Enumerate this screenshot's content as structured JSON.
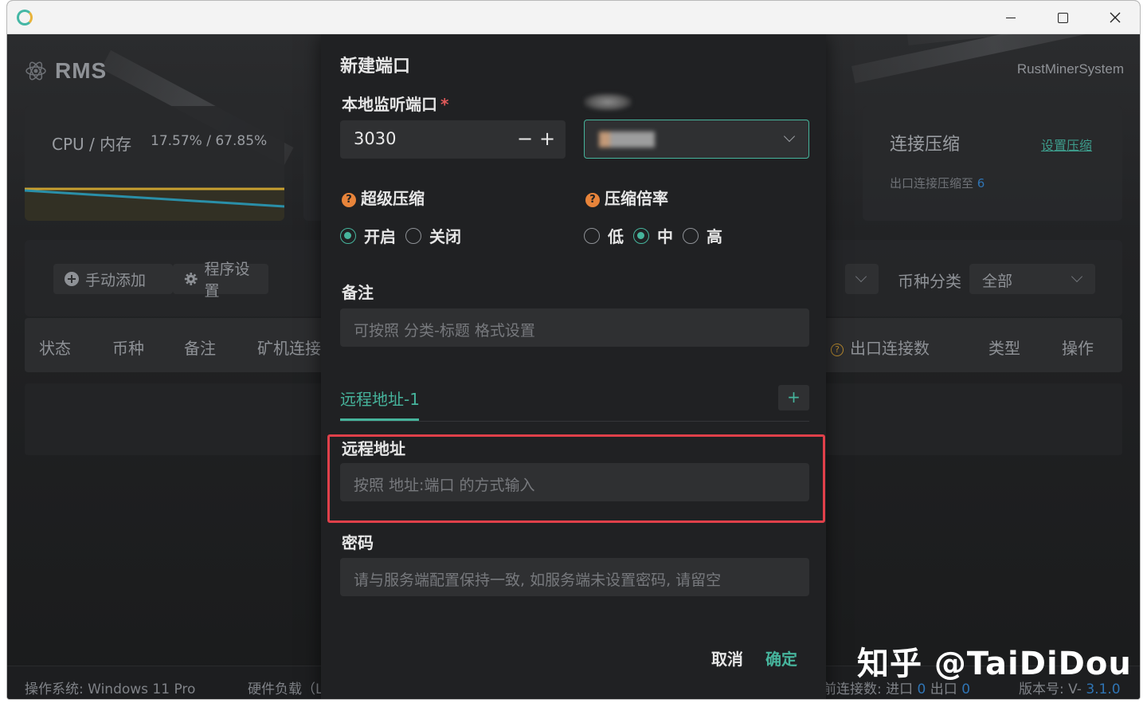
{
  "window": {
    "controls": [
      "minimize",
      "maximize",
      "close"
    ],
    "icon": "app-icon"
  },
  "app": {
    "brand": "RMS",
    "brand_right": "RustMinerSystem",
    "cpu_card": {
      "label": "CPU / 内存",
      "value": "17.57% / 67.85%"
    },
    "compress_card": {
      "title": "连接压缩",
      "link": "设置压缩",
      "desc_prefix": "出口连接压缩至 ",
      "desc_value": "6"
    },
    "toolbar": {
      "add_label": "手动添加",
      "settings_label": "程序设置",
      "filter_label": "币种分类",
      "filter_value": "全部"
    },
    "table": {
      "headers": [
        "状态",
        "币种",
        "备注",
        "矿机连接",
        "出口连接数",
        "类型",
        "操作"
      ]
    },
    "statusbar": {
      "os": "操作系统: Windows 11 Pro",
      "load": "硬件负载（L",
      "conn_prefix": "前连接数: 进口 ",
      "conn_in": "0",
      "conn_mid": " 出口 ",
      "conn_out": "0",
      "version_prefix": "版本号: V- ",
      "version": "3.1.0"
    }
  },
  "modal": {
    "title": "新建端口",
    "port_label": "本地监听端口",
    "port_required": "*",
    "port_value": "3030",
    "minus": "−",
    "plus": "+",
    "super_compress_label": "超级压缩",
    "super_compress_options": [
      "开启",
      "关闭"
    ],
    "super_compress_selected": "开启",
    "ratio_label": "压缩倍率",
    "ratio_options": [
      "低",
      "中",
      "高"
    ],
    "ratio_selected": "中",
    "remark_label": "备注",
    "remark_placeholder": "可按照 分类-标题 格式设置",
    "tab_label": "远程地址-1",
    "tab_add": "+",
    "remote_label": "远程地址",
    "remote_placeholder": "按照 地址:端口 的方式输入",
    "password_label": "密码",
    "password_placeholder": "请与服务端配置保持一致, 如服务端未设置密码, 请留空",
    "cancel": "取消",
    "ok": "确定",
    "help_icon": "?"
  },
  "watermark": "知乎 @TaiDiDou",
  "colors": {
    "accent": "#46b49c",
    "highlight": "#e0404a",
    "help": "#e8843a",
    "link_blue": "#2f74b4"
  }
}
